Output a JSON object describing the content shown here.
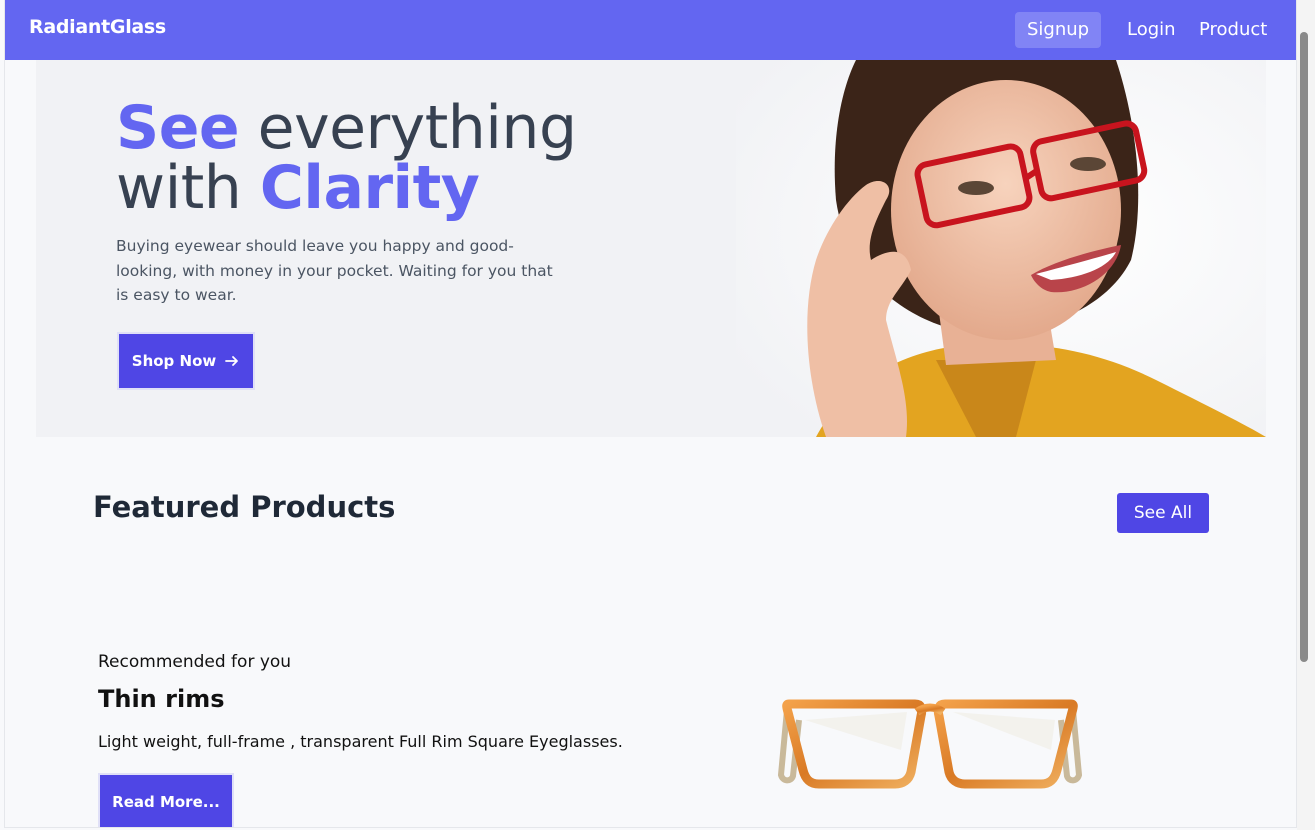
{
  "nav": {
    "brand": "RadiantGlass",
    "signup": "Signup",
    "login": "Login",
    "product": "Product"
  },
  "hero": {
    "title_accent_1": "See",
    "title_rest_1": " everything",
    "title_rest_2": "with ",
    "title_accent_2": "Clarity",
    "description": "Buying eyewear should leave you happy and good-looking, with money in your pocket. Waiting for you that is easy to wear.",
    "cta": "Shop Now"
  },
  "featured": {
    "title": "Featured Products",
    "see_all": "See All",
    "recommended_label": "Recommended for you",
    "product_name": "Thin rims",
    "product_desc": "Light weight, full-frame , transparent Full Rim Square Eyeglasses.",
    "read_more": "Read More..."
  },
  "colors": {
    "nav_bg": "#6366f1",
    "accent": "#6366f1",
    "button": "#4f46e5"
  },
  "icons": [
    "arrow-right-icon",
    "model-photo",
    "glasses-photo"
  ]
}
